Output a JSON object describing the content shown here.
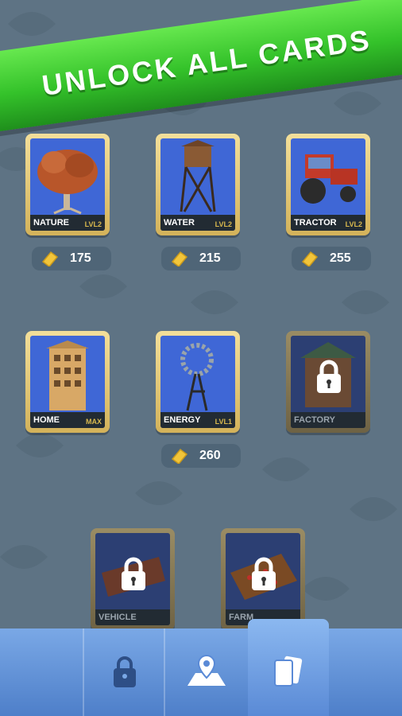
{
  "banner": {
    "title": "UNLOCK ALL CARDS"
  },
  "cards": [
    {
      "name": "NATURE",
      "level": "LVL2",
      "price": "175",
      "locked": false
    },
    {
      "name": "WATER",
      "level": "LVL2",
      "price": "215",
      "locked": false
    },
    {
      "name": "TRACTOR",
      "level": "LVL2",
      "price": "255",
      "locked": false
    },
    {
      "name": "HOME",
      "level": "MAX",
      "price": "",
      "locked": false
    },
    {
      "name": "ENERGY",
      "level": "LVL1",
      "price": "260",
      "locked": false
    },
    {
      "name": "FACTORY",
      "level": "",
      "price": "",
      "locked": true
    },
    {
      "name": "VEHICLE",
      "level": "",
      "price": "",
      "locked": true
    },
    {
      "name": "FARM",
      "level": "",
      "price": "",
      "locked": true
    }
  ],
  "nav": {
    "tabs": [
      {
        "icon": "padlock-icon",
        "active": false
      },
      {
        "icon": "map-pin-icon",
        "active": false
      },
      {
        "icon": "cards-icon",
        "active": true
      }
    ]
  },
  "colors": {
    "banner": "#34c22a",
    "card_frame": "#d3b25a",
    "card_inner": "#3f67d6",
    "nav": "#5a8ad6"
  }
}
